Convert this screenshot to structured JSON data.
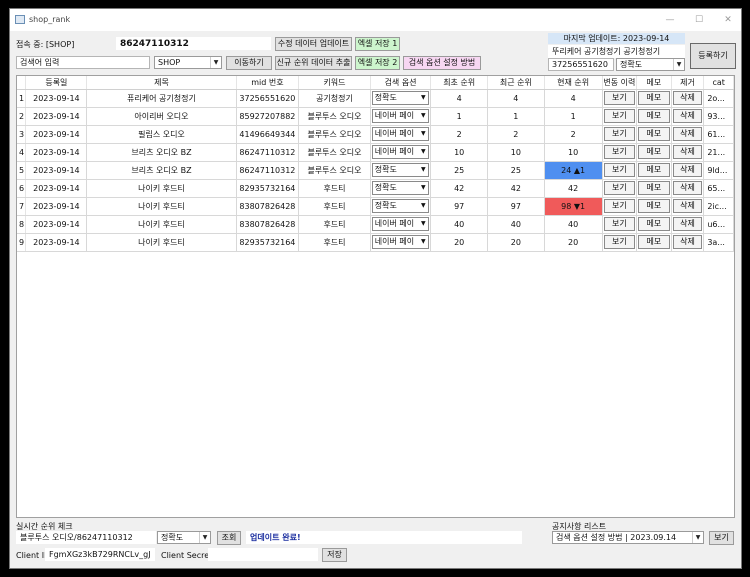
{
  "window": {
    "title": "shop_rank"
  },
  "top": {
    "connected_label": "접속 중: [SHOP]",
    "connected_id": "86247110312",
    "search_input_value": "검색어 입력",
    "shop_select": "SHOP",
    "btn_update_edit": "수정 데이터 업데이트",
    "btn_excel1": "엑셀 저장 1",
    "btn_goto": "이동하기",
    "btn_new_rank": "신규 순위 데이터 추출",
    "btn_excel2": "엑셀 저장 2",
    "btn_search_option": "검색 옵션 설정 방법"
  },
  "register": {
    "last_update": "마지막 업데이트: 2023-09-14",
    "keyword_field": "뚜리케어 공기청정기  공기청정기",
    "mid_field": "37256551620",
    "option_select": "정확도",
    "btn_register": "등록하기"
  },
  "table": {
    "headers": [
      "등록일",
      "제목",
      "mid 번호",
      "키워드",
      "검색 옵션",
      "최초 순위",
      "최근 순위",
      "현재 순위",
      "변동 이력",
      "메모",
      "제거",
      "cat"
    ],
    "btn_view": "보기",
    "btn_memo": "메모",
    "btn_delete": "삭제",
    "rows": [
      {
        "no": "1",
        "date": "2023-09-14",
        "title": "퓨리케어 공기청정기",
        "mid": "37256551620",
        "keyword": "공기청정기",
        "option": "정확도",
        "first": "4",
        "recent": "4",
        "current": "4",
        "cat": "2o...",
        "highlight": ""
      },
      {
        "no": "2",
        "date": "2023-09-14",
        "title": "아이리버 오디오",
        "mid": "85927207882",
        "keyword": "블루투스 오디오",
        "option": "네이버 페이",
        "first": "1",
        "recent": "1",
        "current": "1",
        "cat": "93...",
        "highlight": ""
      },
      {
        "no": "3",
        "date": "2023-09-14",
        "title": "필립스 오디오",
        "mid": "41496649344",
        "keyword": "블루투스 오디오",
        "option": "네이버 페이",
        "first": "2",
        "recent": "2",
        "current": "2",
        "cat": "61...",
        "highlight": ""
      },
      {
        "no": "4",
        "date": "2023-09-14",
        "title": "브리츠 오디오 BZ",
        "mid": "86247110312",
        "keyword": "블루투스 오디오",
        "option": "네이버 페이",
        "first": "10",
        "recent": "10",
        "current": "10",
        "cat": "21...",
        "highlight": ""
      },
      {
        "no": "5",
        "date": "2023-09-14",
        "title": "브리츠 오디오 BZ",
        "mid": "86247110312",
        "keyword": "블루투스 오디오",
        "option": "정확도",
        "first": "25",
        "recent": "25",
        "current": "24 ▲1",
        "cat": "9ld...",
        "highlight": "#4f8ff0"
      },
      {
        "no": "6",
        "date": "2023-09-14",
        "title": "나이키 후드티",
        "mid": "82935732164",
        "keyword": "후드티",
        "option": "정확도",
        "first": "42",
        "recent": "42",
        "current": "42",
        "cat": "65...",
        "highlight": ""
      },
      {
        "no": "7",
        "date": "2023-09-14",
        "title": "나이키 후드티",
        "mid": "83807826428",
        "keyword": "후드티",
        "option": "정확도",
        "first": "97",
        "recent": "97",
        "current": "98 ▼1",
        "cat": "2ic...",
        "highlight": "#f05a5a"
      },
      {
        "no": "8",
        "date": "2023-09-14",
        "title": "나이키 후드티",
        "mid": "83807826428",
        "keyword": "후드티",
        "option": "네이버 페이",
        "first": "40",
        "recent": "40",
        "current": "40",
        "cat": "u6...",
        "highlight": ""
      },
      {
        "no": "9",
        "date": "2023-09-14",
        "title": "나이키 후드티",
        "mid": "82935732164",
        "keyword": "후드티",
        "option": "네이버 페이",
        "first": "20",
        "recent": "20",
        "current": "20",
        "cat": "3a...",
        "highlight": ""
      }
    ]
  },
  "bottom": {
    "realtime_label": "실시간 순위 체크",
    "realtime_value": "블루투스 오디오/86247110312",
    "realtime_option": "정확도",
    "btn_lookup": "조회",
    "status_text": "업데이트 완료!",
    "notice_label": "공지사항 리스트",
    "notice_select": "검색 옵션 설정 방법 | 2023.09.14",
    "btn_notice_view": "보기",
    "client_id_label": "Client ID",
    "client_id_value": "FgmXGz3kB729RNCLv_gJ",
    "client_secret_label": "Client Secret",
    "client_secret_value": "",
    "btn_save": "저장"
  }
}
